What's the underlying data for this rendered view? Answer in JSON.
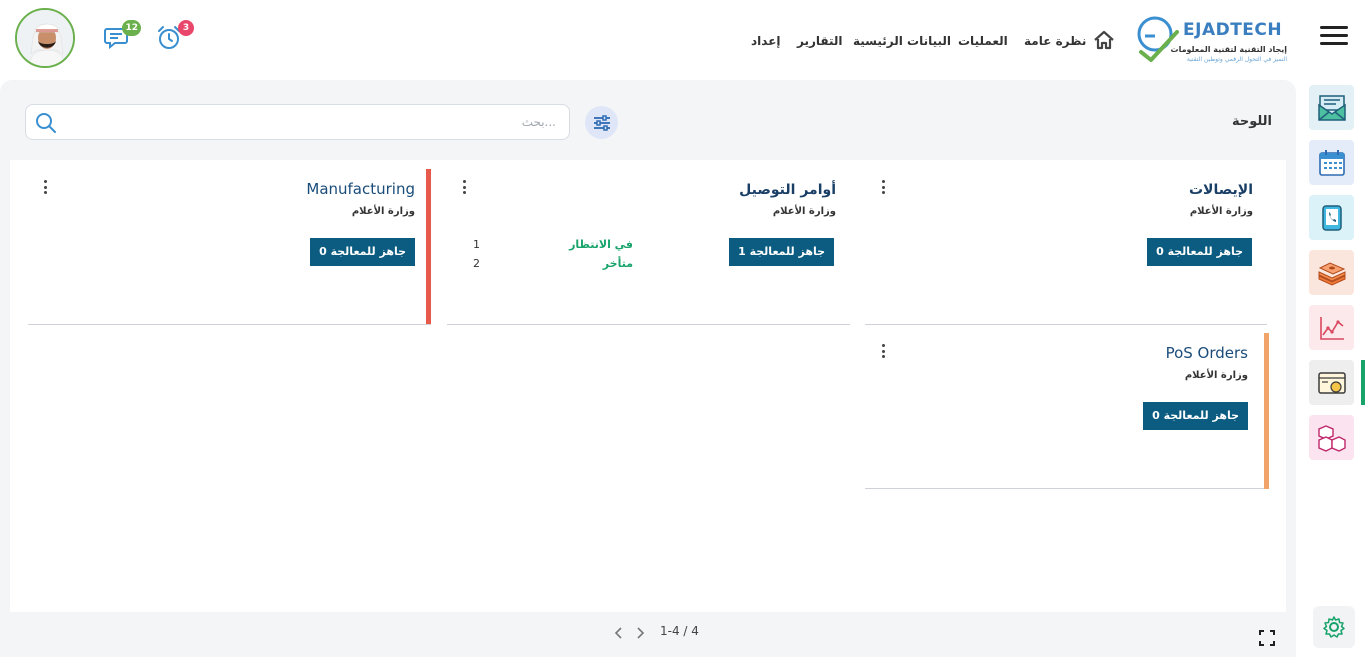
{
  "header": {
    "notifications_count": "12",
    "alerts_count": "3",
    "nav": {
      "setup": "إعداد",
      "reports": "التقارير",
      "master_data": "البيانات الرئيسية",
      "operations": "العمليات",
      "overview": "نظرة عامة"
    },
    "logo": {
      "name": "EJADTECH",
      "tagline": "إيجاد التقنية لتقنية المعلومات",
      "slogan": "التميز في التحول الرقمي وتوطين التقنية"
    }
  },
  "colors": {
    "brand": "#0b5c80",
    "accent_green": "#18a36b",
    "accent_red": "#e7594a",
    "accent_orange": "#f0a46a",
    "badge_green": "#6ab04c",
    "badge_red": "#e8466b"
  },
  "toolbar": {
    "title": "اللوحة",
    "search_placeholder": "...بحث"
  },
  "cards": [
    {
      "title": "الإيصالات",
      "subtitle": "وزارة الأعلام",
      "button": "0 جاهز للمعالجة"
    },
    {
      "title": "أوامر التوصيل",
      "subtitle": "وزارة الأعلام",
      "button": "1 جاهز للمعالجة",
      "stats": [
        {
          "label": "في الانتظار",
          "value": "1"
        },
        {
          "label": "متأخر",
          "value": "2"
        }
      ]
    },
    {
      "title": "Manufacturing",
      "subtitle": "وزارة الأعلام",
      "button": "0 جاهز للمعالجة"
    },
    {
      "title": "PoS Orders",
      "subtitle": "وزارة الأعلام",
      "button": "0 جاهز للمعالجة"
    }
  ],
  "sidebar": {
    "items": [
      {
        "icon": "mail-envelope-icon"
      },
      {
        "icon": "calendar-icon"
      },
      {
        "icon": "phone-tablet-icon"
      },
      {
        "icon": "money-stack-icon"
      },
      {
        "icon": "line-chart-icon"
      },
      {
        "icon": "pos-register-icon"
      },
      {
        "icon": "boxes-icon"
      }
    ],
    "active_index": 5
  },
  "footer": {
    "pager": "1-4 / 4"
  }
}
